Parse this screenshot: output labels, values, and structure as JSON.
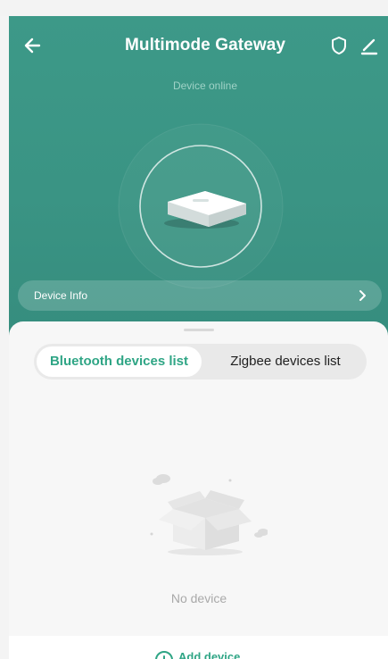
{
  "header": {
    "title": "Multimode Gateway",
    "status": "Device online"
  },
  "device_info": {
    "label": "Device Info"
  },
  "tabs": [
    {
      "label": "Bluetooth devices list",
      "active": true
    },
    {
      "label": "Zigbee devices list",
      "active": false
    }
  ],
  "empty_state": {
    "text": "No device"
  },
  "bottom_action": {
    "label": "Add device"
  },
  "colors": {
    "header_bg": "#3a9484",
    "accent": "#2fa585",
    "sheet_bg": "#f7f7f7"
  },
  "icons": {
    "back": "arrow-left-icon",
    "shield": "shield-icon",
    "edit": "pencil-icon",
    "chevron": "chevron-right-icon",
    "add": "plus-circle-icon"
  }
}
